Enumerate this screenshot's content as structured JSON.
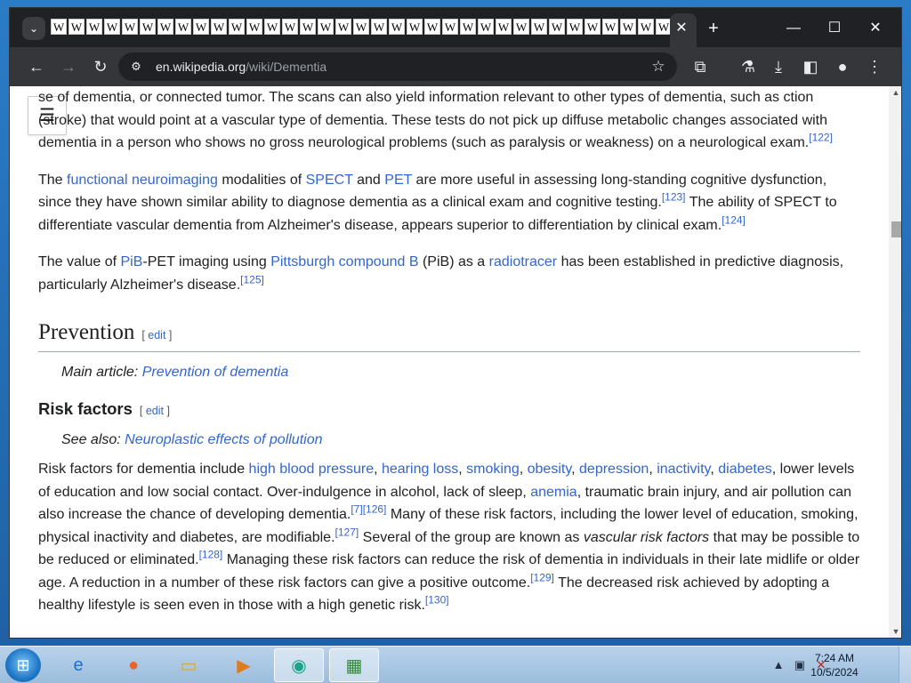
{
  "browser": {
    "tab_favicon_letter": "W",
    "tab_count": 35,
    "tab_close": "✕",
    "new_tab": "+",
    "window_controls": {
      "minimize": "—",
      "maximize": "☐",
      "close": "✕"
    },
    "toolbar": {
      "back": "←",
      "forward": "→",
      "reload": "↻"
    },
    "address": {
      "host": "en.wikipedia.org",
      "path": "/wiki/Dementia"
    },
    "icons": {
      "site_info": "tune-icon",
      "bookmark": "star-icon",
      "extensions": "puzzle-icon",
      "labs": "flask-icon",
      "download": "download-icon",
      "side_panel": "side-panel-icon",
      "profile": "profile-icon",
      "menu": "kebab-menu-icon"
    }
  },
  "article": {
    "toc_icon": "☰",
    "p1": {
      "t1": "se of dementia, or connected tumor. The scans can also yield information relevant to other types of dementia, such as ",
      "t2": "ction (stroke) that would point at a vascular type of dementia. These tests do not pick up diffuse metabolic changes associated with dementia in a person who shows no gross neurological problems (such as paralysis or weakness) on a neurological exam.",
      "ref": "[122]"
    },
    "p2": {
      "t1": "The ",
      "l1": "functional neuroimaging",
      "t2": " modalities of ",
      "l2": "SPECT",
      "t3": " and ",
      "l3": "PET",
      "t4": " are more useful in assessing long-standing cognitive dysfunction, since they have shown similar ability to diagnose dementia as a clinical exam and cognitive testing.",
      "ref1": "[123]",
      "t5": " The ability of SPECT to differentiate vascular dementia from Alzheimer's disease, appears superior to differentiation by clinical exam.",
      "ref2": "[124]"
    },
    "p3": {
      "t1": "The value of ",
      "l1": "PiB",
      "t2": "-PET imaging using ",
      "l2": "Pittsburgh compound B",
      "t3": " (PiB) as a ",
      "l3": "radiotracer",
      "t4": " has been established in predictive diagnosis, particularly Alzheimer's disease.",
      "ref": "[125]"
    },
    "prevention": {
      "heading": "Prevention",
      "edit_open": "[ ",
      "edit_label": "edit",
      "edit_close": " ]",
      "main_article_prefix": "Main article: ",
      "main_article_link": "Prevention of dementia"
    },
    "risk": {
      "heading": "Risk factors",
      "edit_open": "[ ",
      "edit_label": "edit",
      "edit_close": " ]",
      "see_also_prefix": "See also: ",
      "see_also_link": "Neuroplastic effects of pollution",
      "t1": "Risk factors for dementia include ",
      "l1": "high blood pressure",
      "c1": ", ",
      "l2": "hearing loss",
      "c2": ", ",
      "l3": "smoking",
      "c3": ", ",
      "l4": "obesity",
      "c4": ", ",
      "l5": "depression",
      "c5": ", ",
      "l6": "inactivity",
      "c6": ", ",
      "l7": "diabetes",
      "t2": ", lower levels of education and low social contact. Over-indulgence in alcohol, lack of sleep, ",
      "l8": "anemia",
      "t3": ", traumatic brain injury, and air pollution can also increase the chance of developing dementia.",
      "ref1": "[7]",
      "ref2": "[126]",
      "t4": " Many of these risk factors, including the lower level of education, smoking, physical inactivity and diabetes, are modifiable.",
      "ref3": "[127]",
      "t5": " Several of the group are known as ",
      "em": "vascular risk factors",
      "t6": " that may be possible to be reduced or eliminated.",
      "ref4": "[128]",
      "t7": " Managing these risk factors can reduce the risk of dementia in individuals in their late midlife or older age. A reduction in a number of these risk factors can give a positive outcome.",
      "ref5": "[129]",
      "t8": " The decreased risk achieved by adopting a healthy lifestyle is seen even in those with a high genetic risk.",
      "ref6": "[130]"
    }
  },
  "taskbar": {
    "apps": [
      "windows-start",
      "internet-explorer",
      "firefox",
      "file-explorer",
      "media-player",
      "app-green-circle",
      "task-manager"
    ],
    "clock_time": "7:24 AM",
    "clock_date": "10/5/2024"
  }
}
